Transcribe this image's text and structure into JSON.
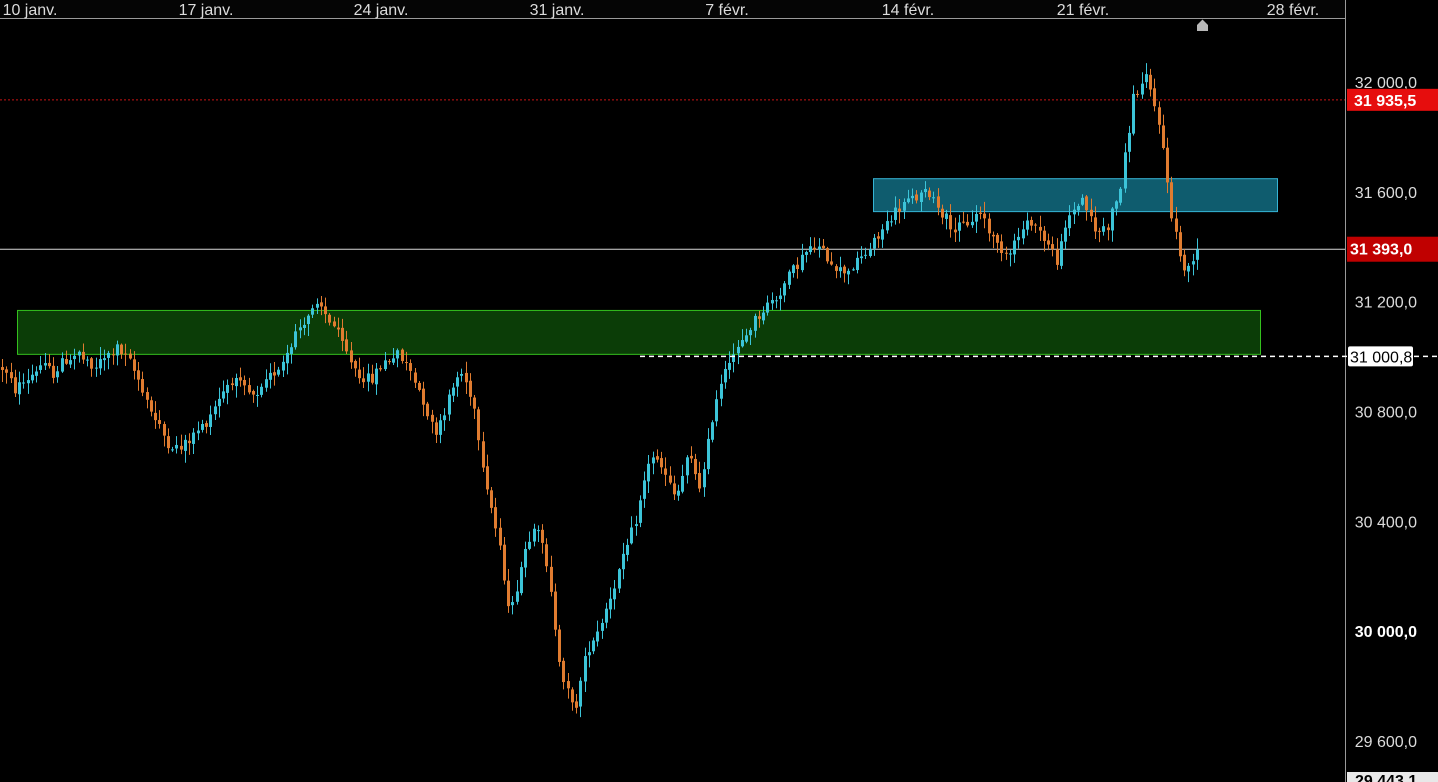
{
  "chart_data": {
    "type": "candlestick",
    "x_axis": {
      "tick_labels": [
        "10 janv.",
        "17 janv.",
        "24 janv.",
        "31 janv.",
        "7 févr.",
        "14 févr.",
        "21 févr.",
        "28 févr."
      ]
    },
    "y_axis": {
      "ylim": [
        29450,
        32230
      ],
      "ticks": [
        {
          "value": 32000,
          "label": "32 000,0"
        },
        {
          "value": 31600,
          "label": "31 600,0"
        },
        {
          "value": 31200,
          "label": "31 200,0"
        },
        {
          "value": 30800,
          "label": "30 800,0"
        },
        {
          "value": 30400,
          "label": "30 400,0"
        },
        {
          "value": 30000,
          "label": "30 000,0",
          "bold": true
        },
        {
          "value": 29600,
          "label": "29 600,0"
        }
      ],
      "bottom_partial_label": "29 443,1"
    },
    "price_levels": [
      {
        "value": 31935.5,
        "label": "31 935,5",
        "line": "dotted",
        "color": "#e01414"
      },
      {
        "value": 31393.0,
        "label": "31 393,0",
        "line": "solid",
        "color": "#c00000"
      },
      {
        "value": 31000.8,
        "label": "31 000,8",
        "line": "dashed",
        "color": "#ffffff"
      }
    ],
    "zones": [
      {
        "name": "resistance-zone",
        "from": 31530,
        "to": 31650,
        "fill": "#0f5c6e",
        "stroke": "#36b4d4"
      },
      {
        "name": "support-zone",
        "from": 31010,
        "to": 31170,
        "fill": "#0b3d07",
        "stroke": "#34c01e"
      }
    ],
    "up_color": "#3cc4d8",
    "down_color": "#e07c30",
    "close_path": [
      30960,
      30880,
      30920,
      30970,
      30940,
      30990,
      31010,
      30950,
      30990,
      31030,
      30980,
      30890,
      30770,
      30690,
      30660,
      30710,
      30760,
      30850,
      30920,
      30880,
      30840,
      30920,
      30980,
      31080,
      31150,
      31180,
      31120,
      31020,
      30940,
      30910,
      30980,
      31010,
      30960,
      30860,
      30720,
      30830,
      30950,
      30850,
      30560,
      30330,
      30060,
      30280,
      30420,
      30180,
      29850,
      29700,
      29930,
      30020,
      30150,
      30280,
      30430,
      30650,
      30580,
      30480,
      30640,
      30520,
      30820,
      30990,
      31030,
      31120,
      31180,
      31220,
      31300,
      31370,
      31400,
      31360,
      31310,
      31330,
      31380,
      31440,
      31520,
      31560,
      31580,
      31600,
      31520,
      31460,
      31490,
      31530,
      31420,
      31380,
      31440,
      31500,
      31430,
      31350,
      31520,
      31580,
      31450,
      31480,
      31620,
      31950,
      32010,
      31860,
      31520,
      31300,
      31400
    ]
  }
}
